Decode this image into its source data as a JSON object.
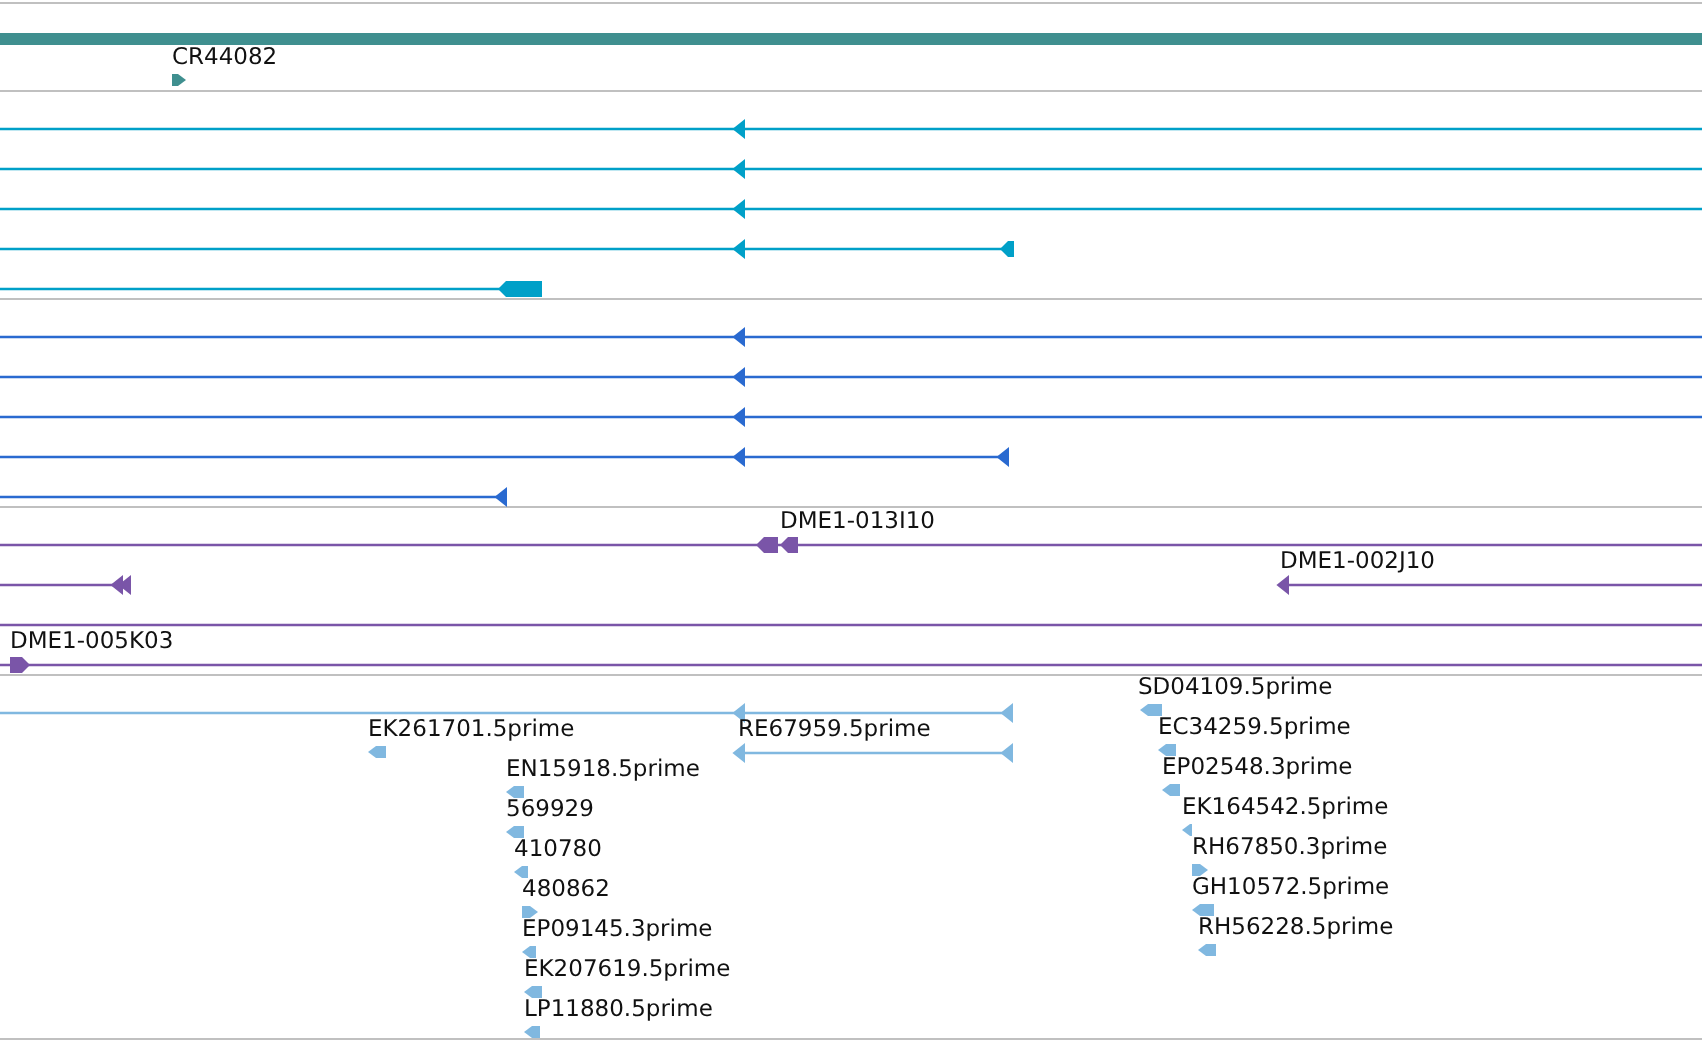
{
  "tracks": [
    {
      "color": "#3f8f8f",
      "features": [
        {
          "kind": "span"
        },
        {
          "kind": "feature",
          "label": "CR44082",
          "reverse": false
        }
      ]
    },
    {
      "color": "#00a0c8",
      "features": [
        {
          "kind": "feature",
          "reverse": true
        },
        {
          "kind": "feature",
          "reverse": true
        },
        {
          "kind": "feature",
          "reverse": true
        },
        {
          "kind": "feature",
          "reverse": true
        },
        {
          "kind": "feature",
          "reverse": true
        }
      ]
    },
    {
      "color": "#2a6ad0",
      "features": [
        {
          "kind": "feature",
          "reverse": true
        },
        {
          "kind": "feature",
          "reverse": true
        },
        {
          "kind": "feature",
          "reverse": true
        },
        {
          "kind": "feature",
          "reverse": true
        },
        {
          "kind": "feature",
          "reverse": true
        }
      ]
    },
    {
      "color": "#7a55a8",
      "features": [
        {
          "kind": "feature",
          "label": "DME1-013I10",
          "reverse": true
        },
        {
          "kind": "feature",
          "reverse": true
        },
        {
          "kind": "feature",
          "label": "DME1-002J10",
          "reverse": true
        },
        {
          "kind": "feature"
        },
        {
          "kind": "feature",
          "label": "DME1-005K03",
          "reverse": false
        }
      ]
    },
    {
      "color": "#80b8e0",
      "features": [
        {
          "kind": "feature",
          "reverse": true
        },
        {
          "kind": "feature",
          "label": "SD04109.5prime",
          "reverse": true
        },
        {
          "kind": "feature",
          "label": "EK261701.5prime",
          "reverse": true
        },
        {
          "kind": "feature",
          "label": "RE67959.5prime",
          "reverse": true
        },
        {
          "kind": "feature",
          "label": "EC34259.5prime",
          "reverse": true
        },
        {
          "kind": "feature",
          "label": "EN15918.5prime",
          "reverse": true
        },
        {
          "kind": "feature",
          "label": "EP02548.3prime",
          "reverse": true
        },
        {
          "kind": "feature",
          "label": "569929",
          "reverse": true
        },
        {
          "kind": "feature",
          "label": "EK164542.5prime",
          "reverse": true
        },
        {
          "kind": "feature",
          "label": "410780",
          "reverse": true
        },
        {
          "kind": "feature",
          "label": "RH67850.3prime",
          "reverse": false
        },
        {
          "kind": "feature",
          "label": "480862",
          "reverse": false
        },
        {
          "kind": "feature",
          "label": "GH10572.5prime",
          "reverse": true
        },
        {
          "kind": "feature",
          "label": "EP09145.3prime",
          "reverse": true
        },
        {
          "kind": "feature",
          "label": "RH56228.5prime",
          "reverse": true
        },
        {
          "kind": "feature",
          "label": "EK207619.5prime",
          "reverse": true
        },
        {
          "kind": "feature",
          "label": "LP11880.5prime",
          "reverse": true
        }
      ]
    }
  ]
}
